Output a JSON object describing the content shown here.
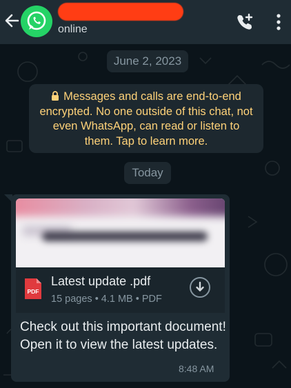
{
  "header": {
    "back_icon": "arrow-left-icon",
    "avatar_icon": "whatsapp-logo-icon",
    "status": "online",
    "call_icon": "add-call-icon",
    "menu_icon": "more-vert-icon",
    "redaction_color": "#ff3d14"
  },
  "chat": {
    "date_label": "June 2, 2023",
    "encryption_notice": "Messages and calls are end-to-end encrypted. No one outside of this chat, not even WhatsApp, can read or listen to them. Tap to learn more.",
    "today_label": "Today",
    "message": {
      "file_name": "Latest update .pdf",
      "file_meta": "15 pages • 4.1 MB • PDF",
      "file_icon_label": "PDF",
      "caption": "Check out this important document! Open it to view the latest updates.",
      "time": "8:48 AM"
    }
  },
  "colors": {
    "header_bg": "#1f2c34",
    "chat_bg": "#0b141a",
    "bubble_bg": "#1f2c34",
    "notice_text": "#ffd279",
    "whatsapp_green": "#25d366",
    "pdf_red": "#e03a3e"
  }
}
